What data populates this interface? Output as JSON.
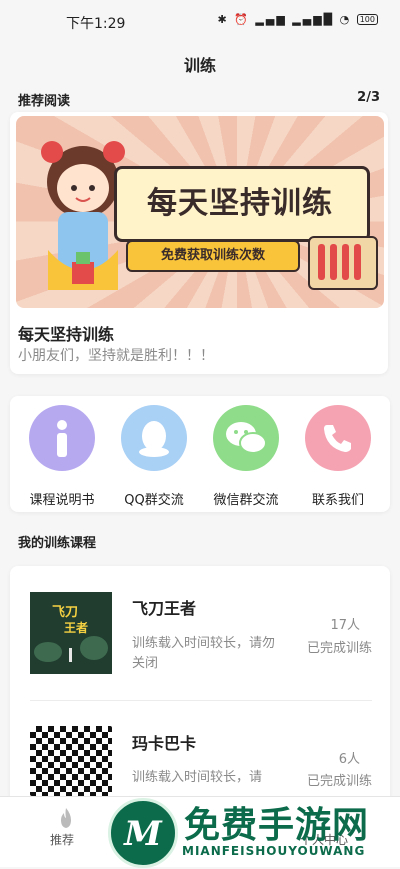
{
  "status": {
    "time": "下午1:29",
    "icons": "✱ ⏰ ▂▄▆ ▂▄▆█ ◔",
    "battery": "100"
  },
  "header": {
    "title": "训练"
  },
  "recommend": {
    "section_title": "推荐阅读",
    "pager": "2/3",
    "banner": {
      "main_text": "每天坚持训练",
      "ribbon_text": "免费获取训练次数"
    },
    "card_title": "每天坚持训练",
    "card_subtitle": "小朋友们，坚持就是胜利！！！"
  },
  "actions": [
    {
      "label": "课程说明书",
      "icon": "info-icon",
      "color": "#b7a9f0"
    },
    {
      "label": "QQ群交流",
      "icon": "qq-icon",
      "color": "#a9d0f5"
    },
    {
      "label": "微信群交流",
      "icon": "wechat-icon",
      "color": "#8fdc8a"
    },
    {
      "label": "联系我们",
      "icon": "phone-icon",
      "color": "#f5a3b3"
    }
  ],
  "courses": {
    "section_title": "我的训练课程",
    "items": [
      {
        "name": "飞刀王者",
        "thumb_text": "飞刀王者",
        "desc": "训练载入时间较长，请勿关闭",
        "count": "17人",
        "status": "已完成训练"
      },
      {
        "name": "玛卡巴卡",
        "desc": "训练载入时间较长，请",
        "count": "6人",
        "status": "已完成训练"
      }
    ]
  },
  "tabbar": {
    "items": [
      {
        "label": "推荐",
        "icon": "fire-icon"
      },
      {
        "label": "个人中心",
        "icon": "user-icon"
      }
    ]
  },
  "watermark": {
    "text": "免费手游网",
    "sub": "MIANFEISHOUYOUWANG",
    "logo_letter": "M"
  }
}
